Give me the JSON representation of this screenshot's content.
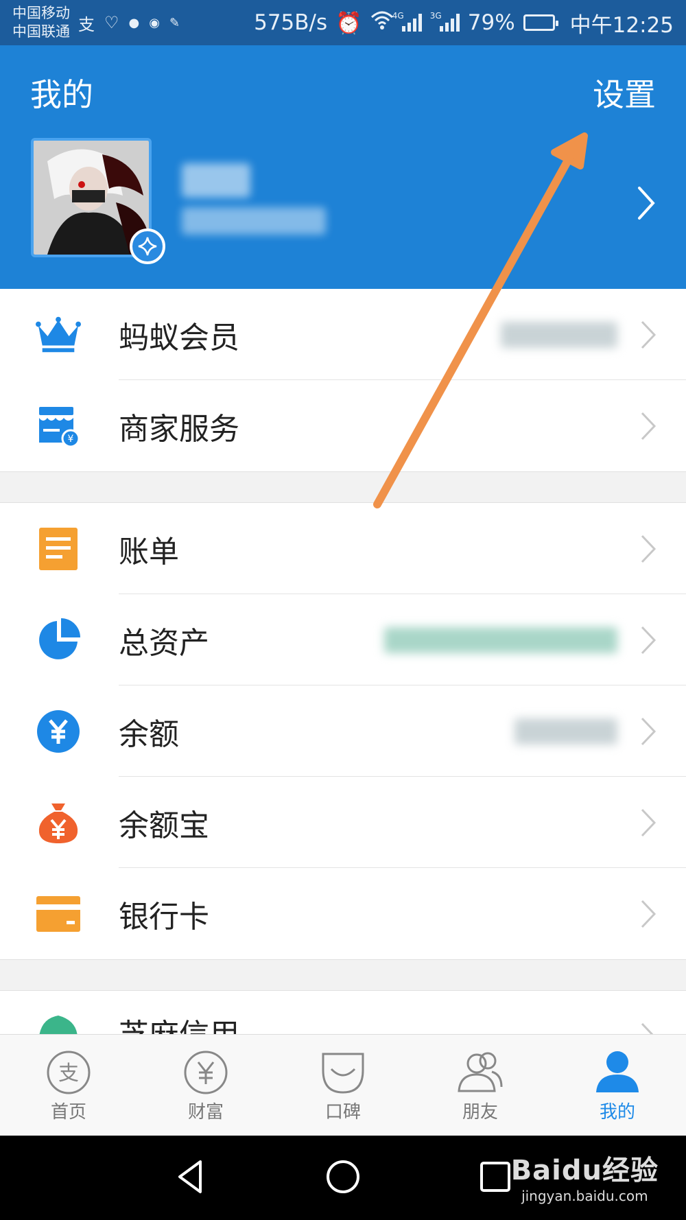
{
  "status_bar": {
    "carrier_1": "中国移动",
    "carrier_2": "中国联通",
    "net_speed": "575B/s",
    "network_1": "4G",
    "network_2": "3G",
    "battery_percent": "79%",
    "battery_level": 0.79,
    "time": "中午12:25",
    "notification_icons": [
      "alipay-icon",
      "heart-rate-icon",
      "app-icon",
      "location-app-icon",
      "pin-icon"
    ]
  },
  "header": {
    "title": "我的",
    "settings_label": "设置",
    "avatar_icon": "anime-avatar",
    "badge_icon": "star-badge-icon"
  },
  "menu_group_1": [
    {
      "label": "蚂蚁会员",
      "icon": "crown-icon",
      "icon_color": "#1e88e5"
    },
    {
      "label": "商家服务",
      "icon": "store-icon",
      "icon_color": "#1e88e5"
    }
  ],
  "menu_group_2": [
    {
      "label": "账单",
      "icon": "bill-icon",
      "icon_color": "#f5a031"
    },
    {
      "label": "总资产",
      "icon": "pie-chart-icon",
      "icon_color": "#1e88e5"
    },
    {
      "label": "余额",
      "icon": "yuan-circle-icon",
      "icon_color": "#1e88e5"
    },
    {
      "label": "余额宝",
      "icon": "money-bag-icon",
      "icon_color": "#f0622d"
    },
    {
      "label": "银行卡",
      "icon": "bank-card-icon",
      "icon_color": "#f5a031"
    }
  ],
  "menu_group_3": [
    {
      "label": "芝麻信用",
      "icon": "sesame-icon",
      "icon_color": "#3bb58a"
    }
  ],
  "tab_bar": [
    {
      "label": "首页",
      "icon": "home-alipay-icon",
      "active": false
    },
    {
      "label": "财富",
      "icon": "wealth-yuan-icon",
      "active": false
    },
    {
      "label": "口碑",
      "icon": "koubei-icon",
      "active": false
    },
    {
      "label": "朋友",
      "icon": "friends-icon",
      "active": false
    },
    {
      "label": "我的",
      "icon": "profile-icon",
      "active": true
    }
  ],
  "nav_bar": {
    "buttons": [
      "back-triangle-icon",
      "home-circle-icon",
      "recents-square-icon"
    ]
  },
  "watermark": {
    "brand": "Baidu经验",
    "url": "jingyan.baidu.com"
  },
  "colors": {
    "header_blue": "#1e82d6",
    "status_bar": "#1c5c9c",
    "active_tab": "#1e8ae8",
    "annotation_arrow": "#f0924a"
  }
}
